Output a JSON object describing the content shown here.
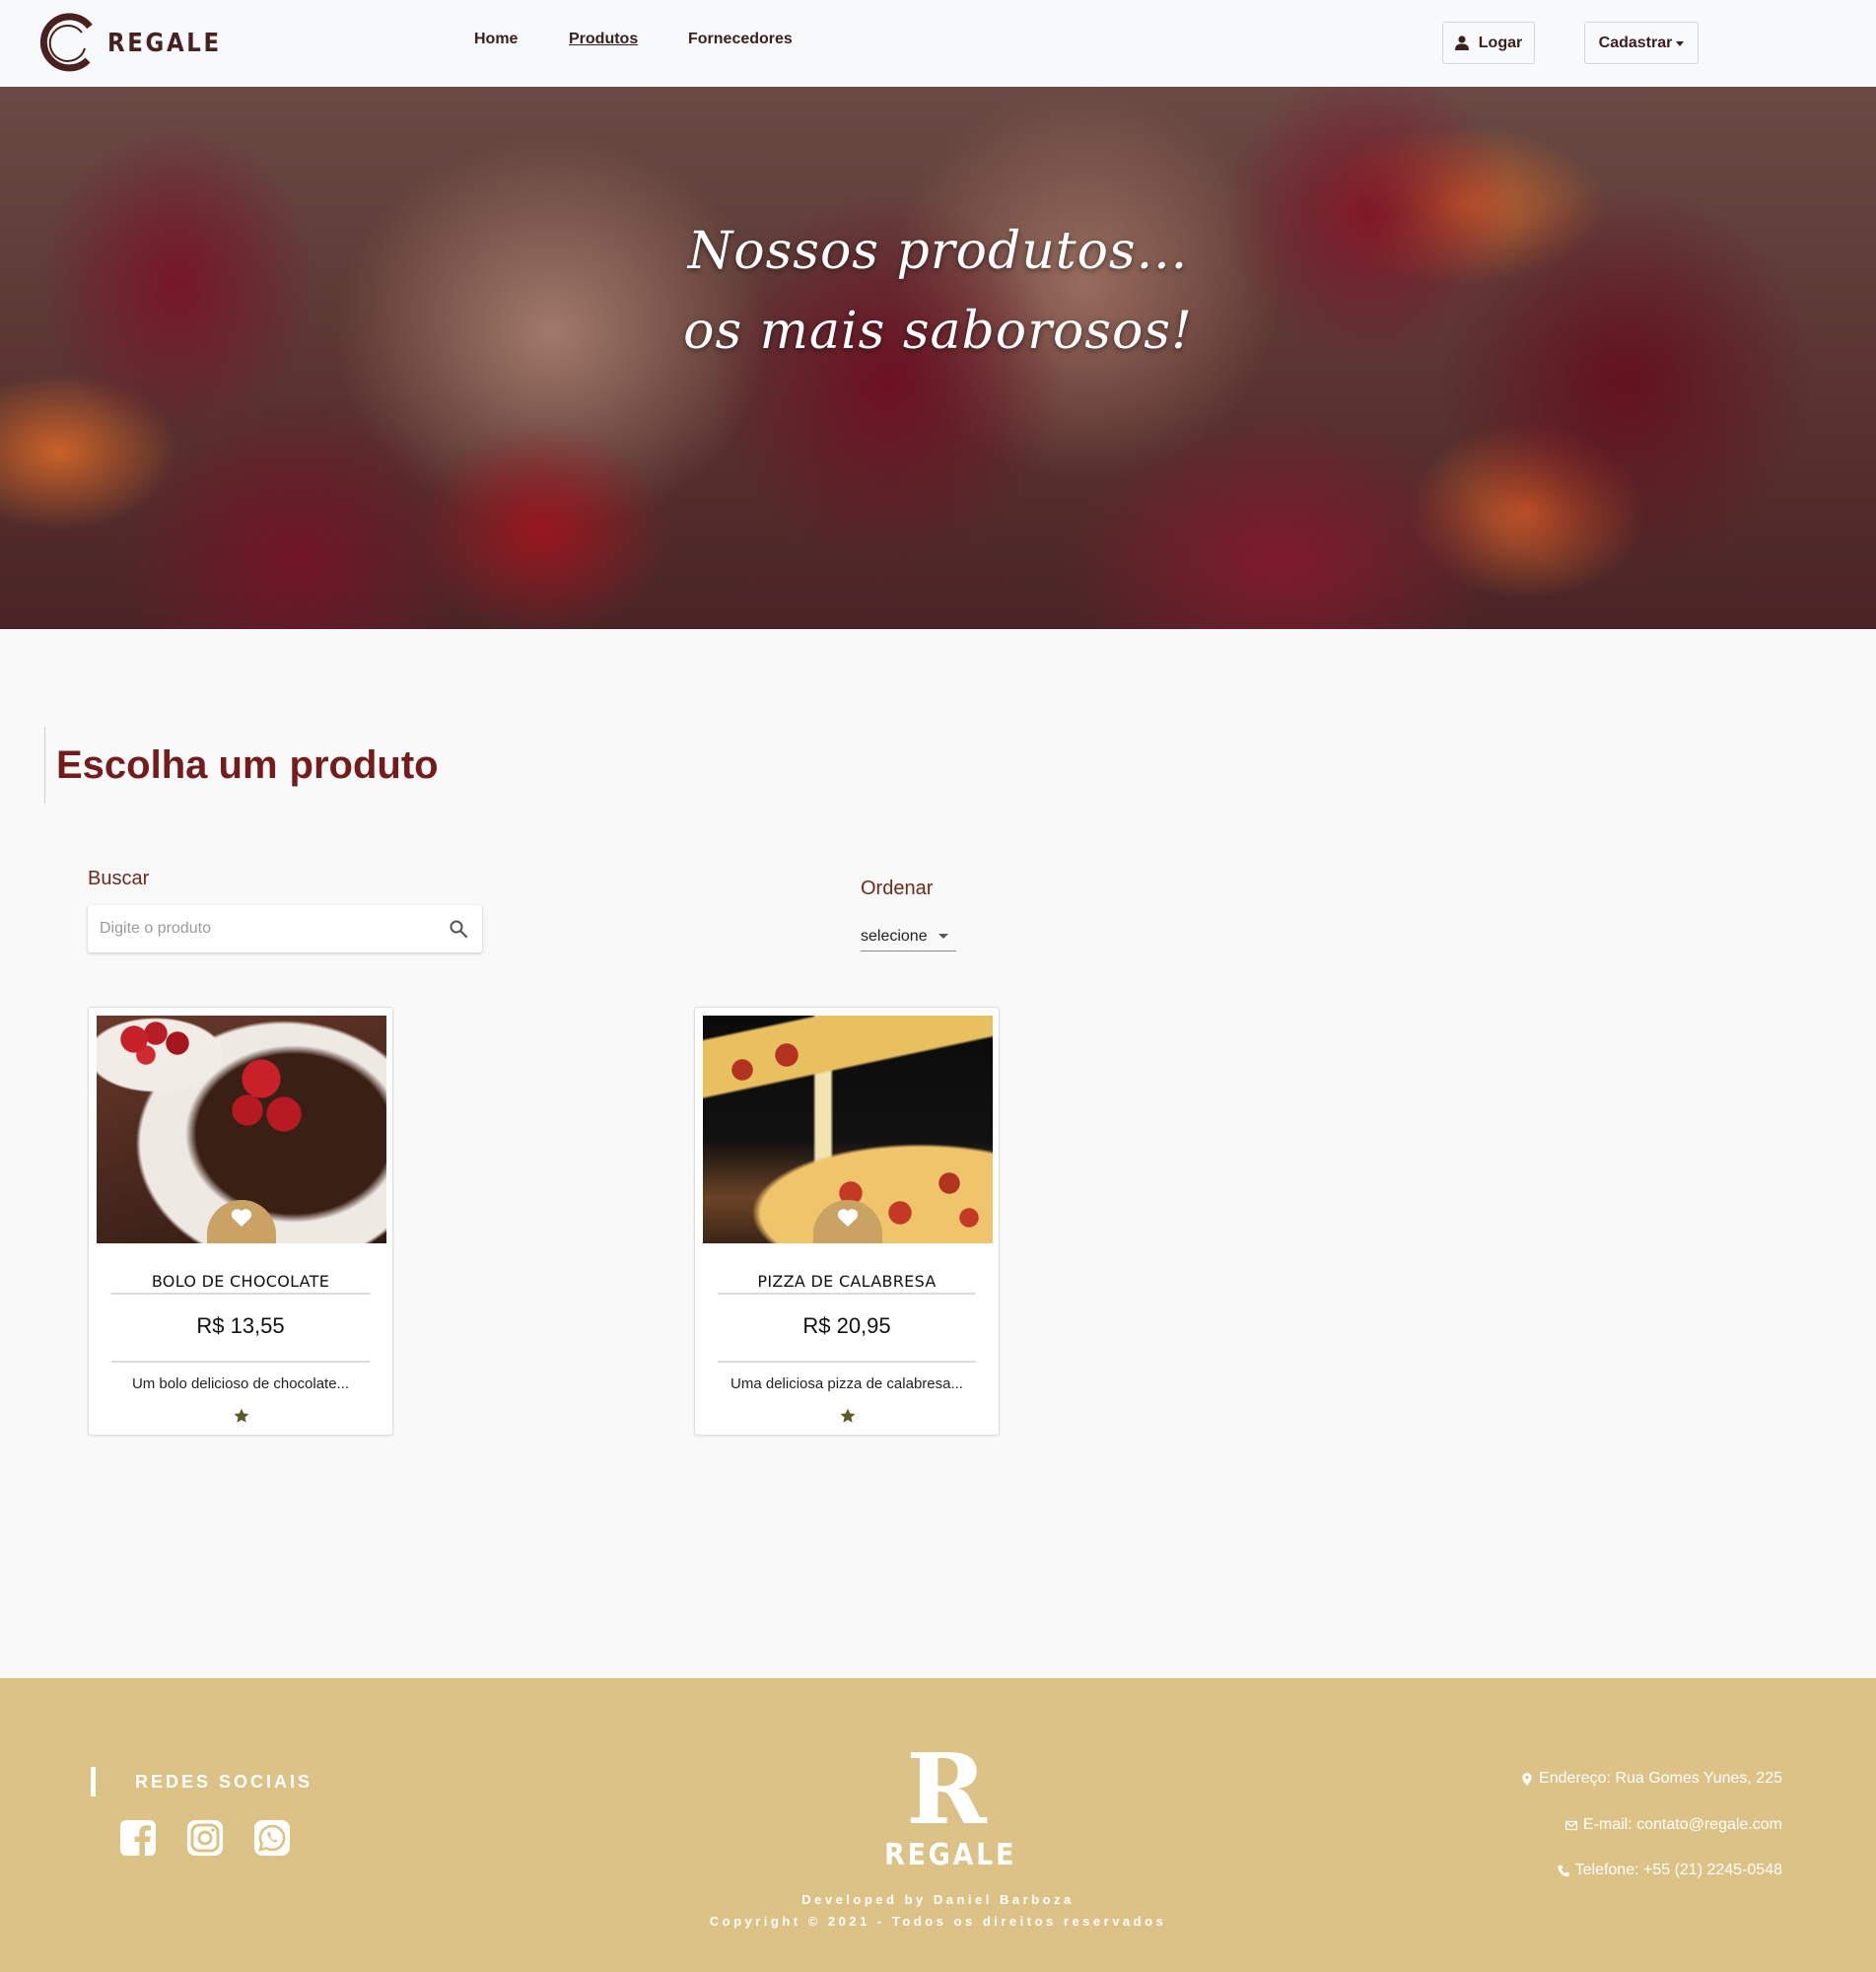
{
  "brand": {
    "name": "REGALE"
  },
  "nav": {
    "items": [
      {
        "label": "Home",
        "active": false
      },
      {
        "label": "Produtos",
        "active": true
      },
      {
        "label": "Fornecedores",
        "active": false
      }
    ],
    "login_label": "Logar",
    "register_label": "Cadastrar"
  },
  "hero": {
    "line1": "Nossos produtos...",
    "line2": "os mais saborosos!"
  },
  "main": {
    "title_prefix": "Escolha um",
    "title_bold": "produto",
    "search": {
      "label": "Buscar",
      "placeholder": "Digite o produto",
      "value": ""
    },
    "sort": {
      "label": "Ordenar",
      "selected": "selecione"
    }
  },
  "products": [
    {
      "name": "BOLO DE CHOCOLATE",
      "price": "R$ 13,55",
      "description": "Um bolo delicioso de chocolate...",
      "rating": 1
    },
    {
      "name": "PIZZA DE CALABRESA",
      "price": "R$ 20,95",
      "description": "Uma deliciosa pizza de calabresa...",
      "rating": 1
    }
  ],
  "footer": {
    "social_title": "REDES SOCIAIS",
    "social_icons": [
      "facebook-icon",
      "instagram-icon",
      "whatsapp-icon"
    ],
    "logo_letter": "R",
    "logo_word": "REGALE",
    "developed_by": "Developed by Daniel Barboza",
    "copyright": "Copyright © 2021 - Todos os direitos reservados",
    "address": "Endereço: Rua Gomes Yunes, 225",
    "email": "E-mail: contato@regale.com",
    "phone": "Telefone: +55 (21) 2245-0548"
  },
  "colors": {
    "primary_text": "#741b1b",
    "footer_bg": "#dcc286",
    "fav_badge": "#c9a264",
    "star": "#5a5a2a"
  }
}
